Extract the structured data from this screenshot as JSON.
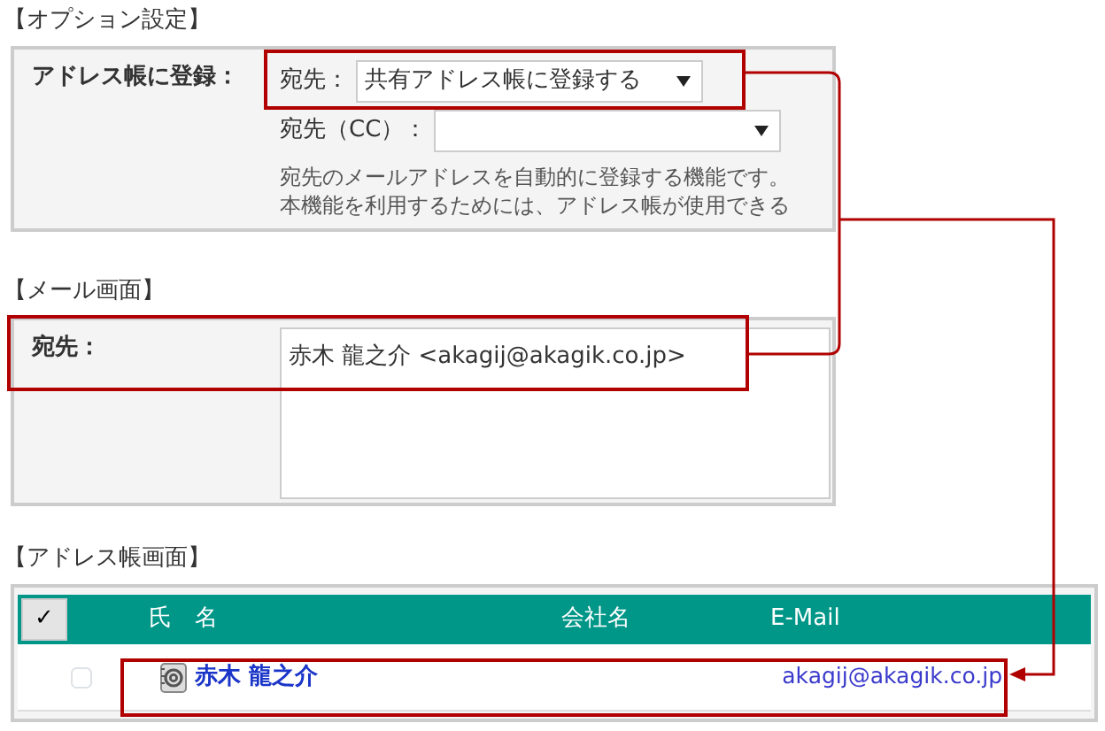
{
  "option_settings": {
    "heading": "【オプション設定】",
    "label": "アドレス帳に登録：",
    "to_label": "宛先：",
    "to_value": "共有アドレス帳に登録する",
    "to_highlighted": true,
    "cc_label": "宛先（CC）：",
    "note_lines": [
      "宛先のメールアドレスを自動的に登録する機能です。",
      "本機能を利用するためには、アドレス帳が使用できる"
    ]
  },
  "mail_screen": {
    "heading": "【メール画面】",
    "to_label": "宛先：",
    "to_value": "赤木 龍之介 <akagij@akagik.co.jp>",
    "highlighted": true
  },
  "address_book": {
    "heading": "【アドレス帳画面】",
    "check_all": "✓",
    "columns": [
      "氏　名",
      "会社名",
      "E-Mail"
    ],
    "rows": [
      {
        "name": "赤木 龍之介",
        "email": "akagij@akagik.co.jp",
        "checked": false,
        "highlighted": true
      }
    ]
  }
}
